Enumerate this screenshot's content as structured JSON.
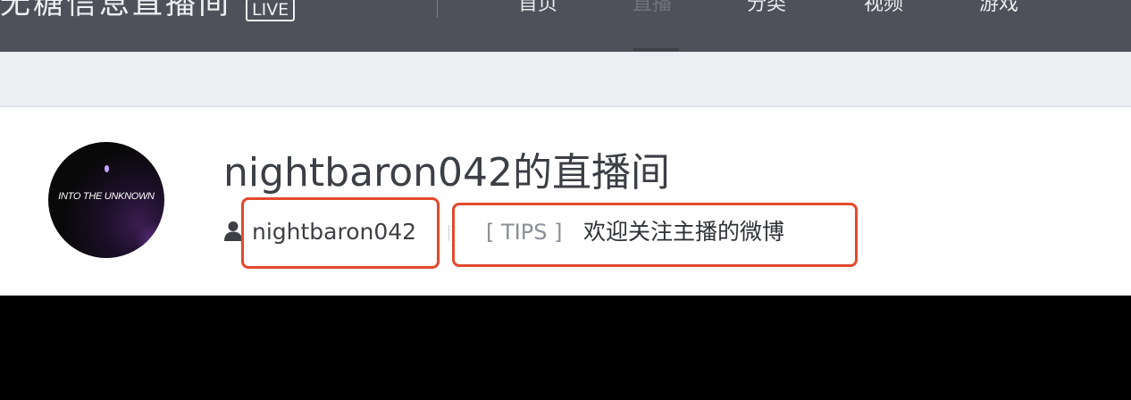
{
  "navbar": {
    "brand_title": "无糖信息直播间",
    "brand_badge": "LIVE",
    "items": [
      {
        "label": "首页"
      },
      {
        "label": "直播"
      },
      {
        "label": "分类"
      },
      {
        "label": "视频"
      },
      {
        "label": "游戏"
      }
    ],
    "active_item": "直播"
  },
  "room": {
    "title": "nightbaron042的直播间",
    "username": "nightbaron042",
    "tips_label": "[ TIPS ]",
    "tips_text": "欢迎关注主播的微博",
    "avatar_text": "INTO THE UNKNOWN"
  },
  "icons": {
    "user": "user-icon"
  },
  "colors": {
    "navbar_bg": "#4e5159",
    "annotation": "#e24a2d",
    "player_bg": "#000000"
  }
}
